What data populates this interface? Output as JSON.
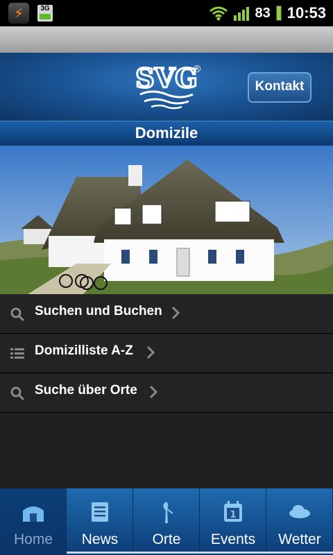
{
  "status_bar": {
    "network_label": "3G",
    "battery_percent": "83",
    "time": "10:53"
  },
  "header": {
    "logo_text": "SVG",
    "registered_mark": "®",
    "contact_button": "Kontakt"
  },
  "page_title": "Domizile",
  "menu": {
    "items": [
      {
        "label": "Suchen und Buchen",
        "icon": "search-icon"
      },
      {
        "label": "Domizilliste A-Z",
        "icon": "list-icon"
      },
      {
        "label": "Suche über Orte",
        "icon": "search-icon"
      }
    ]
  },
  "tabs": [
    {
      "label": "Home",
      "icon": "home-icon",
      "active": true
    },
    {
      "label": "News",
      "icon": "news-icon",
      "active": false
    },
    {
      "label": "Orte",
      "icon": "place-icon",
      "active": false
    },
    {
      "label": "Events",
      "icon": "calendar-icon",
      "active": false
    },
    {
      "label": "Wetter",
      "icon": "weather-icon",
      "active": false
    }
  ],
  "colors": {
    "header_blue": "#1a5595",
    "tab_blue": "#1f6aae",
    "menu_bg": "#232323"
  }
}
